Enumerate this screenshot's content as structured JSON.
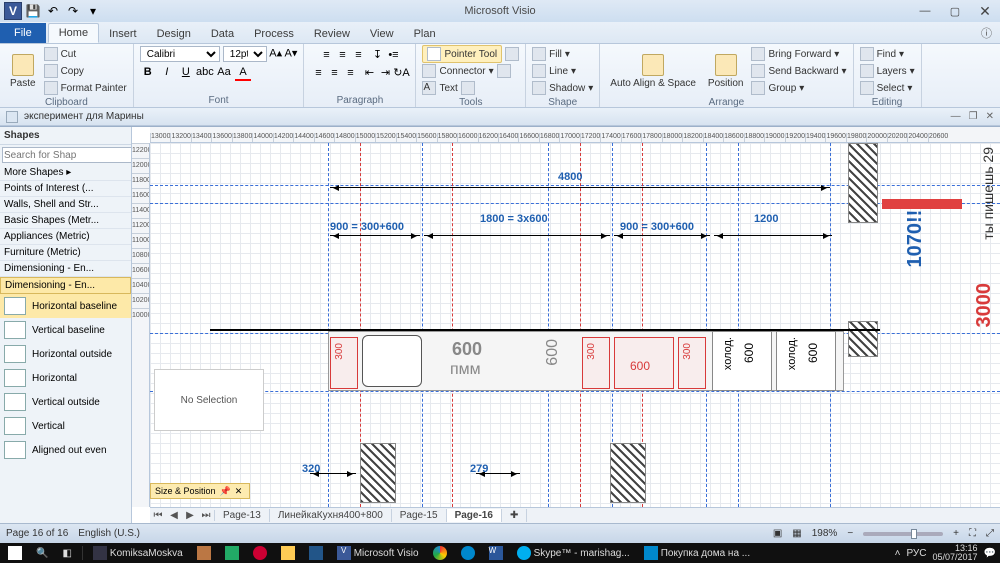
{
  "title": "Microsoft Visio",
  "tabs": [
    "File",
    "Home",
    "Insert",
    "Design",
    "Data",
    "Process",
    "Review",
    "View",
    "Plan"
  ],
  "active_tab": "Home",
  "ribbon": {
    "clipboard": {
      "label": "Clipboard",
      "paste": "Paste",
      "cut": "Cut",
      "copy": "Copy",
      "format_painter": "Format Painter"
    },
    "font": {
      "label": "Font",
      "name": "Calibri",
      "size": "12pt"
    },
    "paragraph": {
      "label": "Paragraph"
    },
    "tools": {
      "label": "Tools",
      "pointer": "Pointer Tool",
      "connector": "Connector",
      "text": "Text"
    },
    "shape": {
      "label": "Shape",
      "fill": "Fill",
      "line": "Line",
      "shadow": "Shadow"
    },
    "arrange": {
      "label": "Arrange",
      "autoalign": "Auto Align & Space",
      "position": "Position",
      "bring": "Bring Forward",
      "send": "Send Backward",
      "group": "Group"
    },
    "editing": {
      "label": "Editing",
      "find": "Find",
      "layers": "Layers",
      "select": "Select"
    }
  },
  "doc_title": "эксперимент для Марины",
  "shapes_pane": {
    "title": "Shapes",
    "search_placeholder": "Search for Shap",
    "more": "More Shapes",
    "cats": [
      "Points of Interest (...",
      "Walls, Shell and Str...",
      "Basic Shapes (Metr...",
      "Appliances (Metric)",
      "Furniture (Metric)",
      "Dimensioning - En...",
      "Dimensioning - En..."
    ],
    "stencils": [
      "Horizontal baseline",
      "Vertical baseline",
      "Horizontal outside",
      "Horizontal",
      "Vertical outside",
      "Vertical",
      "Aligned out even"
    ],
    "nosel": "No Selection"
  },
  "size_pos": "Size & Position",
  "ruler_h": [
    "13000",
    "13200",
    "13400",
    "13600",
    "13800",
    "14000",
    "14200",
    "14400",
    "14600",
    "14800",
    "15000",
    "15200",
    "15400",
    "15600",
    "15800",
    "16000",
    "16200",
    "16400",
    "16600",
    "16800",
    "17000",
    "17200",
    "17400",
    "17600",
    "17800",
    "18000",
    "18200",
    "18400",
    "18600",
    "18800",
    "19000",
    "19200",
    "19400",
    "19600",
    "19800",
    "20000",
    "20200",
    "20400",
    "20600"
  ],
  "ruler_v": [
    "12200",
    "12000",
    "11800",
    "11600",
    "11400",
    "11200",
    "11000",
    "10800",
    "10600",
    "10400",
    "10200",
    "10000"
  ],
  "drawing": {
    "d4800": "4800",
    "d900l": "900 = 300+600",
    "d1800": "1800 = 3х600",
    "d900r": "900 = 300+600",
    "d1200": "1200",
    "d1070": "1070!!!",
    "d3000": "3000",
    "cyr": "ты пишешь 29",
    "d600pmm_a": "600",
    "d600pmm_b": "пмм",
    "d600v": "600",
    "d300a": "300",
    "d300b": "300",
    "d300c": "300",
    "d600r": "600",
    "hold1": "холод.",
    "g600a": "600",
    "hold2": "холод.",
    "g600b": "600",
    "d320": "320",
    "d279": "279"
  },
  "page_tabs": [
    "Page-13",
    "ЛинейкаКухня400+800",
    "Page-15",
    "Page-16"
  ],
  "active_page": "Page-16",
  "status": {
    "page": "Page 16 of 16",
    "lang": "English (U.S.)",
    "zoom": "198%"
  },
  "taskbar": {
    "items": [
      "KomiksaMoskva",
      "Microsoft Visio",
      "Skype™ - marishag...",
      "Покупка дома на ..."
    ],
    "lang": "РУС",
    "time": "13:16",
    "date": "05/07/2017"
  }
}
